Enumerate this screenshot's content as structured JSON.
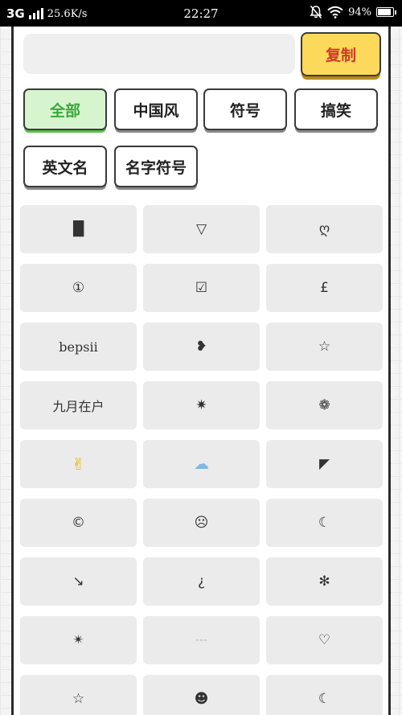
{
  "status_bar": {
    "network": "3G",
    "speed": "25.6K/s",
    "time": "22:27",
    "battery": "94%",
    "battery_level": 0.94
  },
  "copy_bar": {
    "input_value": "",
    "copy_label": "复制"
  },
  "tabs": [
    {
      "label": "全部",
      "active": true
    },
    {
      "label": "中国风",
      "active": false
    },
    {
      "label": "符号",
      "active": false
    },
    {
      "label": "搞笑",
      "active": false
    },
    {
      "label": "英文名",
      "active": false
    },
    {
      "label": "名字符号",
      "active": false
    }
  ],
  "symbols": [
    "█",
    "▽",
    "ღ",
    "①",
    "☑",
    "£",
    "bepsii",
    "❥",
    "☆",
    "九月在户",
    "✷",
    "❁",
    "✌",
    "☁",
    "◤",
    "©",
    "☹",
    "☾",
    "↘",
    "¿",
    "✻",
    "✴",
    "---",
    "♡",
    "☆",
    "☻",
    "☾"
  ],
  "colors": {
    "copy_button_bg": "#fcd95a",
    "copy_button_text": "#d0392b",
    "active_tab_bg": "#d6f5cf",
    "active_tab_text": "#3aa83a",
    "cell_bg": "#ebebeb"
  }
}
